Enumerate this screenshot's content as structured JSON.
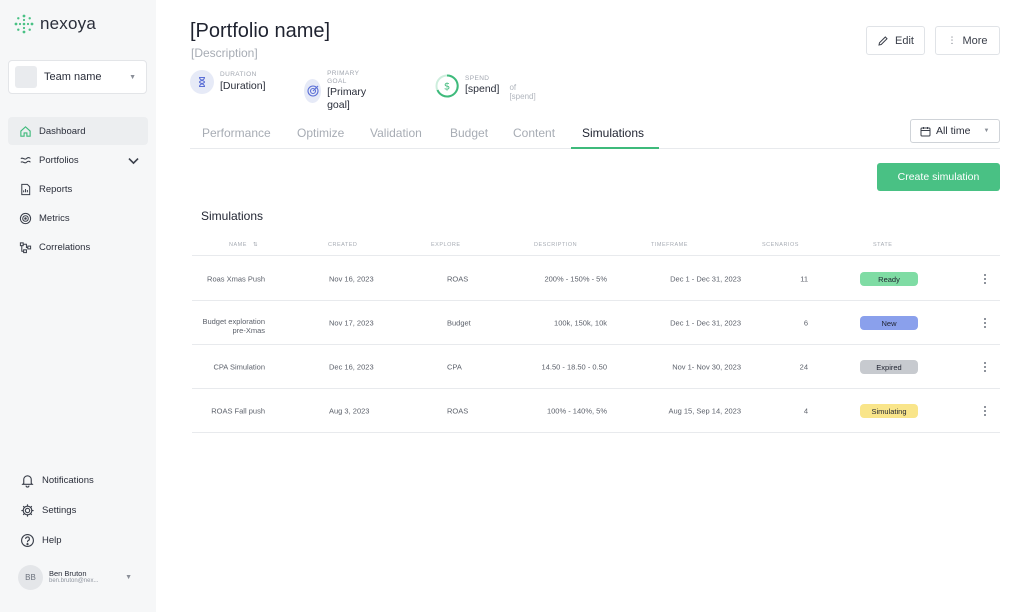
{
  "brand": {
    "name": "nexoya"
  },
  "team": {
    "name": "Team name"
  },
  "nav": [
    {
      "label": "Dashboard",
      "icon": "home-icon"
    },
    {
      "label": "Portfolios",
      "icon": "portfolio-icon"
    },
    {
      "label": "Reports",
      "icon": "report-icon"
    },
    {
      "label": "Metrics",
      "icon": "metrics-icon"
    },
    {
      "label": "Correlations",
      "icon": "correlations-icon"
    }
  ],
  "bottom_nav": [
    {
      "label": "Notifications",
      "icon": "bell-icon"
    },
    {
      "label": "Settings",
      "icon": "gear-icon"
    },
    {
      "label": "Help",
      "icon": "help-icon"
    }
  ],
  "user": {
    "initials": "BB",
    "name": "Ben Bruton",
    "email": "ben.bruton@nex..."
  },
  "header": {
    "title": "[Portfolio name]",
    "description": "[Description]",
    "edit_label": "Edit",
    "more_label": "More"
  },
  "stats": {
    "duration": {
      "label": "DURATION",
      "value": "[Duration]"
    },
    "goal": {
      "label": "PRIMARY GOAL",
      "value": "[Primary goal]"
    },
    "spend": {
      "label": "SPEND",
      "value": "[spend]",
      "of": "of [spend]"
    }
  },
  "tabs": [
    "Performance",
    "Optimize",
    "Validation",
    "Budget",
    "Content",
    "Simulations"
  ],
  "active_tab": "Simulations",
  "time_filter": "All time",
  "create_label": "Create simulation",
  "section_title": "Simulations",
  "table": {
    "headers": {
      "name": "NAME",
      "created": "CREATED",
      "explore": "EXPLORE",
      "description": "DESCRIPTION",
      "timeframe": "TIMEFRAME",
      "scenarios": "SCENARIOS",
      "state": "STATE"
    },
    "rows": [
      {
        "name": "Roas Xmas Push",
        "name2": "",
        "created": "Nov 16, 2023",
        "explore": "ROAS",
        "description": "200% - 150% - 5%",
        "timeframe": "Dec 1 - Dec 31, 2023",
        "scenarios": "11",
        "state": "Ready",
        "state_color": "#7fdca4"
      },
      {
        "name": "Budget exploration",
        "name2": "pre-Xmas",
        "created": "Nov 17, 2023",
        "explore": "Budget",
        "description": "100k, 150k, 10k",
        "timeframe": "Dec 1 - Dec 31, 2023",
        "scenarios": "6",
        "state": "New",
        "state_color": "#8aa0ec"
      },
      {
        "name": "CPA Simulation",
        "name2": "",
        "created": "Dec 16, 2023",
        "explore": "CPA",
        "description": "14.50 - 18.50 - 0.50",
        "timeframe": "Nov 1- Nov 30, 2023",
        "scenarios": "24",
        "state": "Expired",
        "state_color": "#c7cacf"
      },
      {
        "name": "ROAS Fall push",
        "name2": "",
        "created": "Aug 3, 2023",
        "explore": "ROAS",
        "description": "100% - 140%, 5%",
        "timeframe": "Aug 15, Sep 14, 2023",
        "scenarios": "4",
        "state": "Simulating",
        "state_color": "#f9e58a"
      }
    ]
  },
  "colors": {
    "accent": "#49c184",
    "tab_underline": "#3eba7b"
  }
}
